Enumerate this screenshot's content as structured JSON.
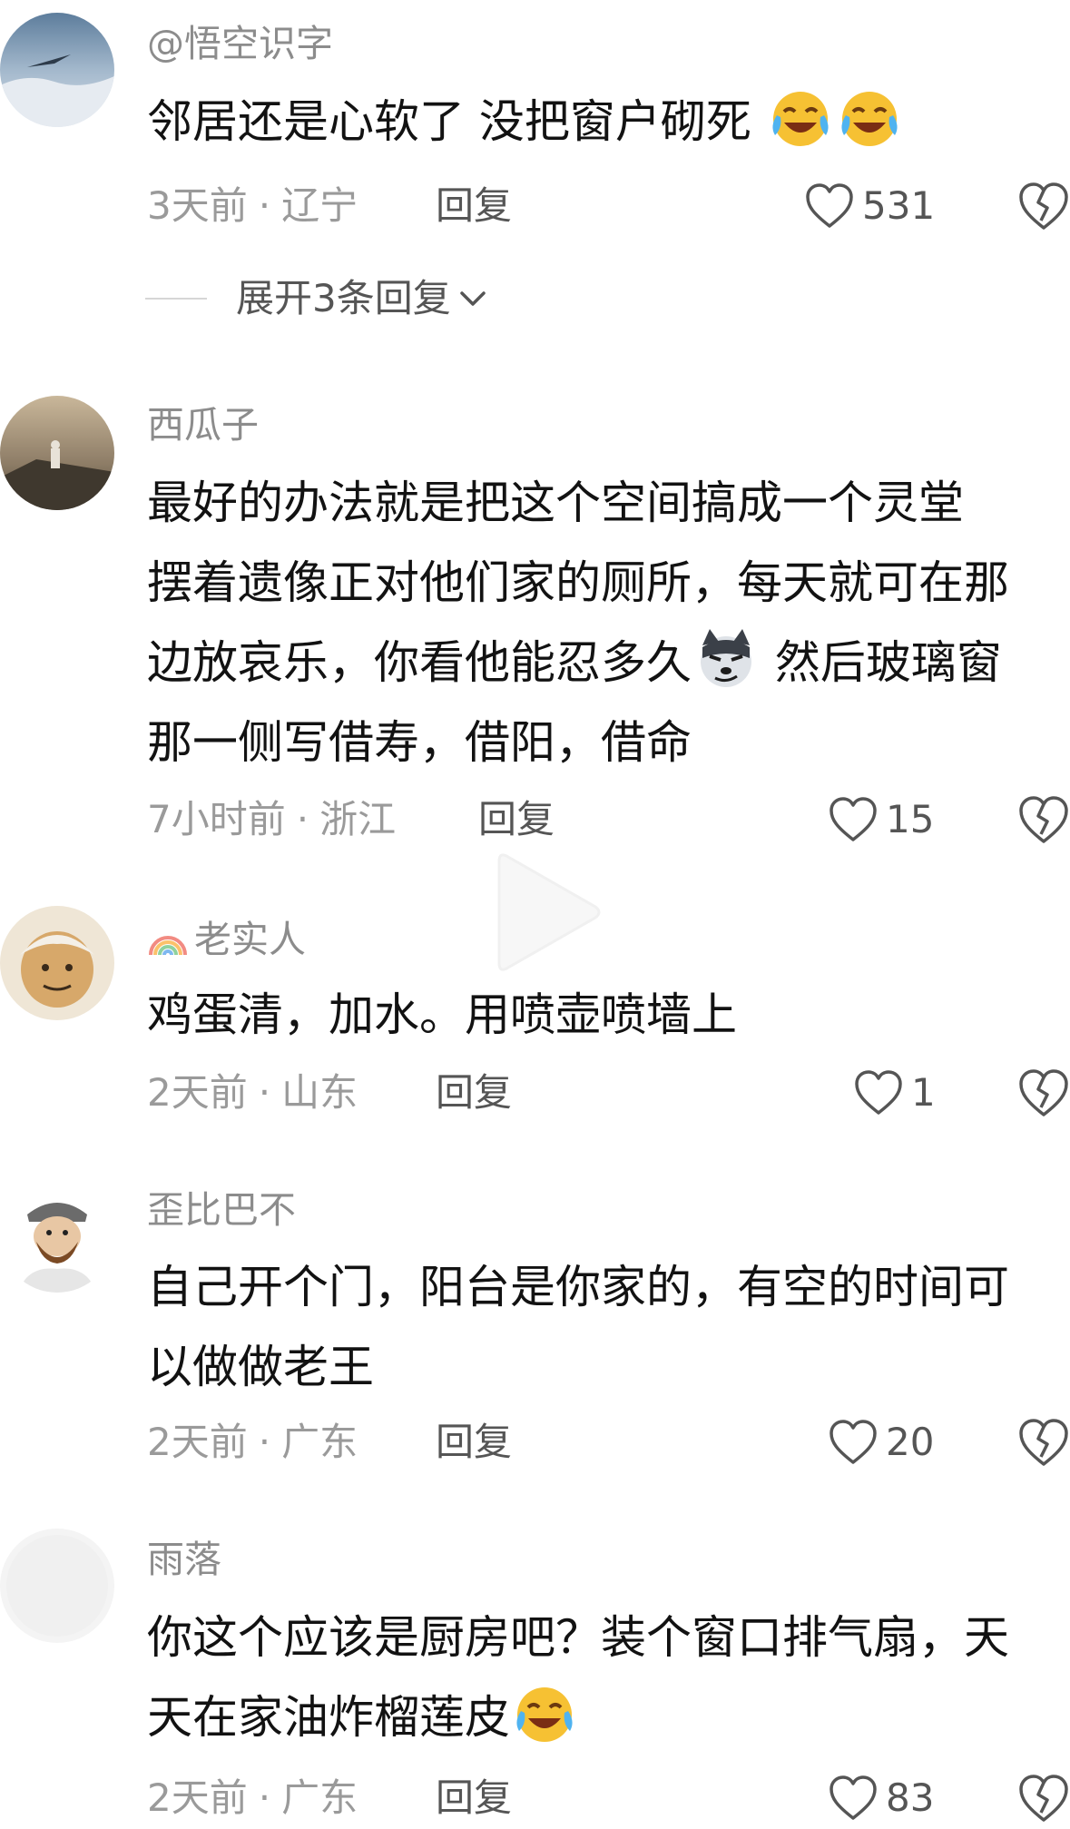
{
  "comments": [
    {
      "username": "@悟空识字",
      "lines": [
        "邻居还是心软了 没把窗户砌死"
      ],
      "emoji": "crying-laughing-face-emoji",
      "time": "3天前",
      "location": "辽宁",
      "reply_label": "回复",
      "likes": "531",
      "expand_label": "展开3条回复"
    },
    {
      "username": "西瓜子",
      "lines": [
        "最好的办法就是把这个空间搞成一个灵堂",
        "摆着遗像正对他们家的厕所，每天就可在那",
        "边放哀乐，你看他能忍多久",
        "那一侧写借寿，借阳，借命"
      ],
      "line3_tail": "然后玻璃窗",
      "emoji": "smirking-wolf-emoji",
      "time": "7小时前",
      "location": "浙江",
      "reply_label": "回复",
      "likes": "15"
    },
    {
      "username": "老实人",
      "username_prefix_icon": "rainbow-icon",
      "lines": [
        "鸡蛋清，加水。用喷壶喷墙上"
      ],
      "time": "2天前",
      "location": "山东",
      "reply_label": "回复",
      "likes": "1"
    },
    {
      "username": "歪比巴不",
      "lines": [
        "自己开个门，阳台是你家的，有空的时间可",
        "以做做老王"
      ],
      "time": "2天前",
      "location": "广东",
      "reply_label": "回复",
      "likes": "20"
    },
    {
      "username": "雨落",
      "lines": [
        "你这个应该是厨房吧？装个窗口排气扇，天",
        "天在家油炸榴莲皮"
      ],
      "emoji": "crying-laughing-face-emoji",
      "time": "2天前",
      "location": "广东",
      "reply_label": "回复",
      "likes": "83"
    }
  ],
  "meta_separator": "·",
  "colors": {
    "text": "#121212",
    "username": "#8c8c8c",
    "meta": "#9a9a9a",
    "action": "#555555",
    "background": "#ffffff"
  }
}
